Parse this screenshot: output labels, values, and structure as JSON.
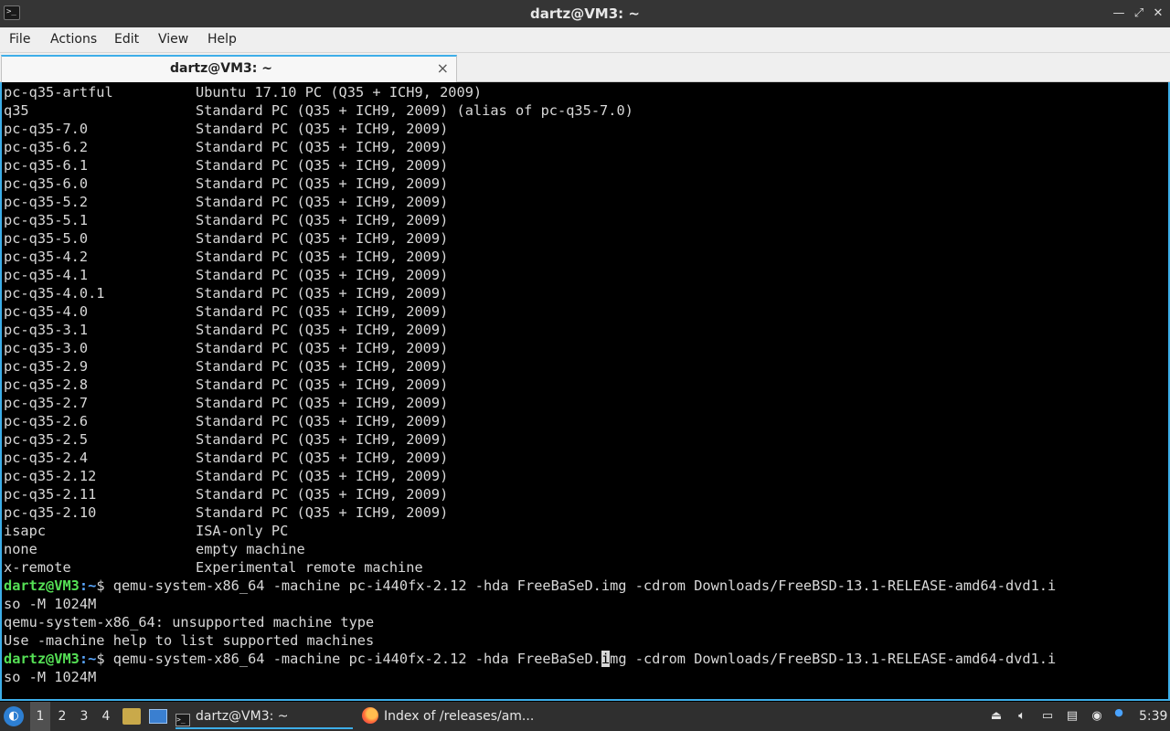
{
  "window": {
    "title": "dartz@VM3: ~",
    "app_icon": "terminal-icon",
    "controls": {
      "minimize": "—",
      "maximize": "⤢",
      "close": "✕"
    }
  },
  "menubar": {
    "items": [
      "File",
      "Actions",
      "Edit",
      "View",
      "Help"
    ]
  },
  "tab": {
    "label": "dartz@VM3: ~",
    "close": "×"
  },
  "terminal": {
    "machines": [
      [
        "pc-q35-artful",
        "Ubuntu 17.10 PC (Q35 + ICH9, 2009)"
      ],
      [
        "q35",
        "Standard PC (Q35 + ICH9, 2009) (alias of pc-q35-7.0)"
      ],
      [
        "pc-q35-7.0",
        "Standard PC (Q35 + ICH9, 2009)"
      ],
      [
        "pc-q35-6.2",
        "Standard PC (Q35 + ICH9, 2009)"
      ],
      [
        "pc-q35-6.1",
        "Standard PC (Q35 + ICH9, 2009)"
      ],
      [
        "pc-q35-6.0",
        "Standard PC (Q35 + ICH9, 2009)"
      ],
      [
        "pc-q35-5.2",
        "Standard PC (Q35 + ICH9, 2009)"
      ],
      [
        "pc-q35-5.1",
        "Standard PC (Q35 + ICH9, 2009)"
      ],
      [
        "pc-q35-5.0",
        "Standard PC (Q35 + ICH9, 2009)"
      ],
      [
        "pc-q35-4.2",
        "Standard PC (Q35 + ICH9, 2009)"
      ],
      [
        "pc-q35-4.1",
        "Standard PC (Q35 + ICH9, 2009)"
      ],
      [
        "pc-q35-4.0.1",
        "Standard PC (Q35 + ICH9, 2009)"
      ],
      [
        "pc-q35-4.0",
        "Standard PC (Q35 + ICH9, 2009)"
      ],
      [
        "pc-q35-3.1",
        "Standard PC (Q35 + ICH9, 2009)"
      ],
      [
        "pc-q35-3.0",
        "Standard PC (Q35 + ICH9, 2009)"
      ],
      [
        "pc-q35-2.9",
        "Standard PC (Q35 + ICH9, 2009)"
      ],
      [
        "pc-q35-2.8",
        "Standard PC (Q35 + ICH9, 2009)"
      ],
      [
        "pc-q35-2.7",
        "Standard PC (Q35 + ICH9, 2009)"
      ],
      [
        "pc-q35-2.6",
        "Standard PC (Q35 + ICH9, 2009)"
      ],
      [
        "pc-q35-2.5",
        "Standard PC (Q35 + ICH9, 2009)"
      ],
      [
        "pc-q35-2.4",
        "Standard PC (Q35 + ICH9, 2009)"
      ],
      [
        "pc-q35-2.12",
        "Standard PC (Q35 + ICH9, 2009)"
      ],
      [
        "pc-q35-2.11",
        "Standard PC (Q35 + ICH9, 2009)"
      ],
      [
        "pc-q35-2.10",
        "Standard PC (Q35 + ICH9, 2009)"
      ],
      [
        "isapc",
        "ISA-only PC"
      ],
      [
        "none",
        "empty machine"
      ],
      [
        "x-remote",
        "Experimental remote machine"
      ]
    ],
    "prompt_user": "dartz@VM3",
    "prompt_path": ":~",
    "prompt_symbol": "$ ",
    "command1_line1": "qemu-system-x86_64 -machine pc-i440fx-2.12 -hda FreeBaSeD.img -cdrom Downloads/FreeBSD-13.1-RELEASE-amd64-dvd1.i",
    "command1_line2": "so -M 1024M",
    "error_line1": "qemu-system-x86_64: unsupported machine type",
    "error_line2": "Use -machine help to list supported machines",
    "command2_before_cursor": "qemu-system-x86_64 -machine pc-i440fx-2.12 -hda FreeBaSeD.",
    "command2_cursor_char": "i",
    "command2_after_cursor": "mg -cdrom Downloads/FreeBSD-13.1-RELEASE-amd64-dvd1.i",
    "command2_line2": "so -M 1024M"
  },
  "taskbar": {
    "start_icon": "app-menu-icon",
    "workspaces": [
      "1",
      "2",
      "3",
      "4"
    ],
    "active_workspace": "1",
    "launchers": [
      "file-manager-icon",
      "show-desktop-icon"
    ],
    "tasks": [
      {
        "label": "dartz@VM3: ~",
        "icon": "terminal-icon",
        "active": true
      },
      {
        "label": "Index of /releases/am...",
        "icon": "firefox-icon",
        "active": false
      }
    ],
    "tray": [
      "eject-icon",
      "volume-icon",
      "display-icon",
      "clipboard-icon",
      "network-icon",
      "update-notifier-icon"
    ],
    "clock": "5:39"
  }
}
